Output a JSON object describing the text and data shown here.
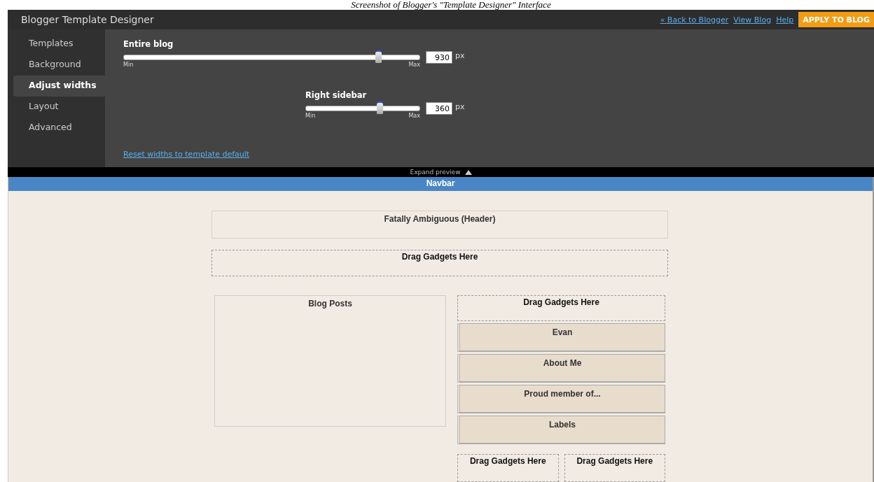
{
  "caption": "Screenshot of Blogger's \"Template Designer\" Interface",
  "topbar": {
    "title": "Blogger Template Designer",
    "links": [
      "« Back to Blogger",
      "View Blog",
      "Help"
    ],
    "apply_button": "APPLY TO BLOG"
  },
  "sidebar": {
    "items": [
      {
        "label": "Templates",
        "selected": false
      },
      {
        "label": "Background",
        "selected": false
      },
      {
        "label": "Adjust widths",
        "selected": true
      },
      {
        "label": "Layout",
        "selected": false
      },
      {
        "label": "Advanced",
        "selected": false
      }
    ]
  },
  "sliders": [
    {
      "label": "Entire blog",
      "level": 0.86,
      "value": "930",
      "unit": "px",
      "min_label": "Min",
      "max_label": "Max"
    },
    {
      "label": "Right sidebar",
      "level": 0.65,
      "value": "360",
      "unit": "px",
      "min_label": "Min",
      "max_label": "Max"
    }
  ],
  "reset_link": "Reset widths to template default",
  "expand_preview": "Expand preview",
  "preview": {
    "navbar": "Navbar",
    "header": "Fatally Ambiguous (Header)",
    "top_drop": "Drag Gadgets Here",
    "blog_posts": "Blog Posts",
    "sidebar_drop": "Drag Gadgets Here",
    "gadgets": [
      "Evan",
      "About Me",
      "Proud member of...",
      "Labels"
    ],
    "bottom_drops": [
      "Drag Gadgets Here",
      "Drag Gadgets Here"
    ]
  }
}
